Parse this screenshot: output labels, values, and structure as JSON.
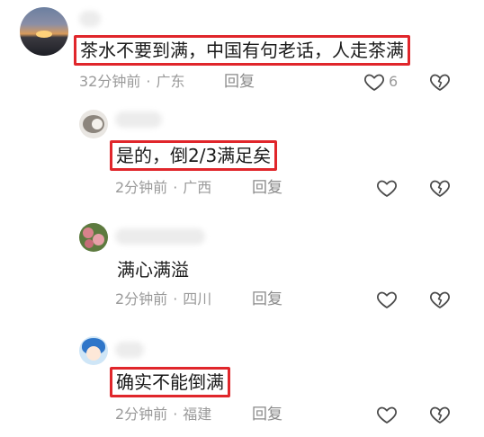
{
  "comments": [
    {
      "text": "茶水不要到满，中国有句老话，人走茶满",
      "time": "32分钟前",
      "location": "广东",
      "reply_label": "回复",
      "like_count": "6",
      "avatar": "sunset-avatar"
    },
    {
      "text": "是的，倒2/3满足矣",
      "time": "2分钟前",
      "location": "广西",
      "reply_label": "回复",
      "avatar": "cat-avatar"
    },
    {
      "text": "满心满溢",
      "time": "2分钟前",
      "location": "四川",
      "reply_label": "回复",
      "avatar": "flowers-avatar"
    },
    {
      "text": "确实不能倒满",
      "time": "2分钟前",
      "location": "福建",
      "reply_label": "回复",
      "avatar": "cartoon-avatar"
    }
  ],
  "meta_separator": "·",
  "icons": {
    "like": "heart-outline-icon",
    "dislike": "broken-heart-icon"
  },
  "colors": {
    "highlight_box": "#e0262b",
    "meta_text": "#9a9a9a",
    "body_text": "#1a1a1a"
  }
}
